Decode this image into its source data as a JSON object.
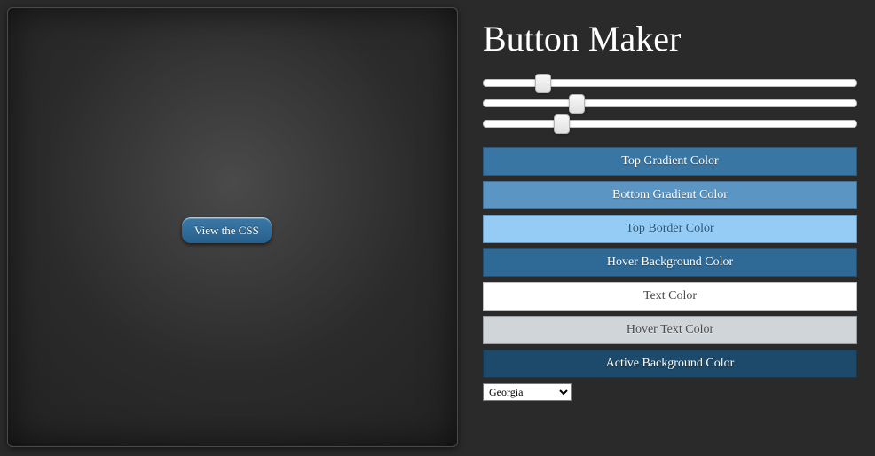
{
  "preview": {
    "button_label": "View the CSS"
  },
  "controls": {
    "title": "Button Maker",
    "sliders": [
      {
        "value_percent": 16
      },
      {
        "value_percent": 25
      },
      {
        "value_percent": 21
      }
    ],
    "color_rows": [
      {
        "label": "Top Gradient Color",
        "color": "#3a76a4",
        "text": "#ffffff"
      },
      {
        "label": "Bottom Gradient Color",
        "color": "#5a95c3",
        "text": "#ffffff"
      },
      {
        "label": "Top Border Color",
        "color": "#94ccf6",
        "text": "#275678"
      },
      {
        "label": "Hover Background Color",
        "color": "#2f6a96",
        "text": "#ffffff"
      },
      {
        "label": "Text Color",
        "color": "#ffffff",
        "text": "#4a4a4a"
      },
      {
        "label": "Hover Text Color",
        "color": "#d0d5d9",
        "text": "#4a4a4a"
      },
      {
        "label": "Active Background Color",
        "color": "#1d4a6b",
        "text": "#ffffff"
      }
    ],
    "font_selector": {
      "selected": "Georgia"
    }
  }
}
